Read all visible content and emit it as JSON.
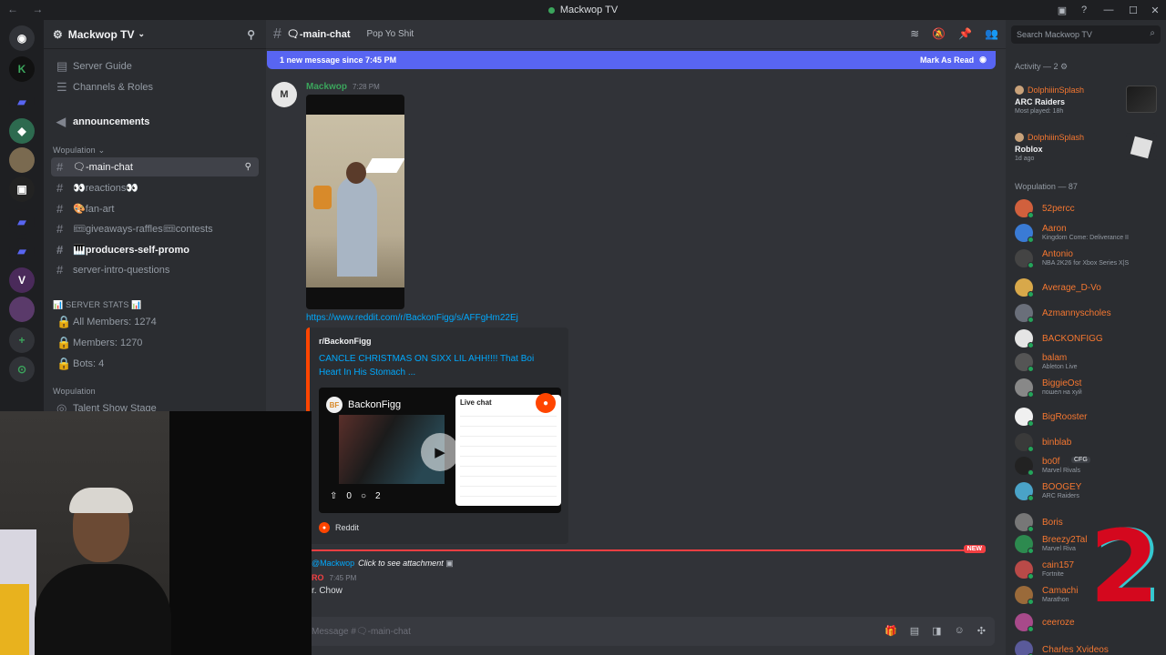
{
  "window": {
    "title": "Mackwop TV"
  },
  "server": {
    "name": "Mackwop TV"
  },
  "sidebar": {
    "top_items": [
      {
        "label": "Server Guide"
      },
      {
        "label": "Channels & Roles"
      }
    ],
    "announcements": "announcements",
    "category1": "Wopulation",
    "channels": [
      {
        "label": "🗨-main-chat"
      },
      {
        "label": "👀reactions👀"
      },
      {
        "label": "🎨fan-art"
      },
      {
        "label": "🎟giveaways-raffles🎟contests"
      },
      {
        "label": "🎹producers-self-promo"
      },
      {
        "label": "server-intro-questions"
      }
    ],
    "stats_category": "📊 SERVER STATS 📊",
    "stats": [
      {
        "label": "All Members: 1274"
      },
      {
        "label": "Members: 1270"
      },
      {
        "label": "Bots: 4"
      }
    ],
    "category2": "Wopulation",
    "stage": "Talent Show Stage"
  },
  "chat": {
    "channel": "🗨-main-chat",
    "topic": "Pop Yo Shit",
    "new_bar": "1 new message since 7:45 PM",
    "mark_read": "Mark As Read",
    "message1": {
      "user": "Mackwop",
      "time": "7:28 PM",
      "link": "https://www.reddit.com/r/BackonFigg/s/AFFgHm22Ej",
      "embed_provider": "r/BackonFigg",
      "embed_title": "CANCLE CHRISTMAS ON SIXX LIL AHH!!!! That Boi Heart In His Stomach ...",
      "thumb_channel": "BackonFigg",
      "thumb_live": "Live chat",
      "thumb_upvotes": "0",
      "thumb_comments": "2",
      "footer": "Reddit"
    },
    "new_tag": "NEW",
    "reply_mention": "@Mackwop",
    "reply_attachment": "Click to see attachment",
    "message2": {
      "user": "RO",
      "time": "7:45 PM",
      "text": "r. Chow"
    },
    "composer_placeholder": "Message #🗨-main-chat"
  },
  "members": {
    "search_placeholder": "Search Mackwop TV",
    "activity_header": "Activity — 2",
    "activities": [
      {
        "user": "DolphiiinSplash",
        "game": "ARC Raiders",
        "sub": "Most played: 18h"
      },
      {
        "user": "DolphiiinSplash",
        "game": "Roblox",
        "sub": "1d ago"
      }
    ],
    "group_header": "Wopulation — 87",
    "list": [
      {
        "name": "52percc",
        "sub": "",
        "color": "#f57731"
      },
      {
        "name": "Aaron",
        "sub": "Kingdom Come: Deliverance II",
        "color": "#f57731"
      },
      {
        "name": "Antonio",
        "sub": "NBA 2K26 for Xbox Series X|S",
        "color": "#f57731"
      },
      {
        "name": "Average_D-Vo",
        "sub": "",
        "color": "#f57731"
      },
      {
        "name": "Azmannyscholes",
        "sub": "",
        "color": "#f57731"
      },
      {
        "name": "BACKONFIGG",
        "sub": "",
        "color": "#f57731"
      },
      {
        "name": "balam",
        "sub": "Ableton Live",
        "color": "#f57731"
      },
      {
        "name": "BiggieOst",
        "sub": "пошел на хуй",
        "color": "#f57731"
      },
      {
        "name": "BigRooster",
        "sub": "",
        "color": "#f57731"
      },
      {
        "name": "binblab",
        "sub": "",
        "color": "#f57731"
      },
      {
        "name": "bo0f",
        "sub": "Marvel Rivals",
        "color": "#f57731"
      },
      {
        "name": "BOOGEY",
        "sub": "ARC Raiders",
        "color": "#f57731"
      },
      {
        "name": "Boris",
        "sub": "",
        "color": "#f57731"
      },
      {
        "name": "Breezy2Tal",
        "sub": "Marvel Riva",
        "color": "#f57731"
      },
      {
        "name": "cain157",
        "sub": "Fortnite",
        "color": "#f57731"
      },
      {
        "name": "Camachi",
        "sub": "Marathon",
        "color": "#f57731"
      },
      {
        "name": "ceeroze",
        "sub": "",
        "color": "#f57731"
      },
      {
        "name": "Charles Xvideos",
        "sub": "",
        "color": "#f57731"
      }
    ],
    "bo0f_tag": "CFG"
  },
  "overlay": {
    "big_text": "2"
  },
  "colors": {
    "accent": "#5865f2",
    "online": "#23a55a",
    "member_name": "#f57731",
    "unread_line": "#f23f42"
  }
}
